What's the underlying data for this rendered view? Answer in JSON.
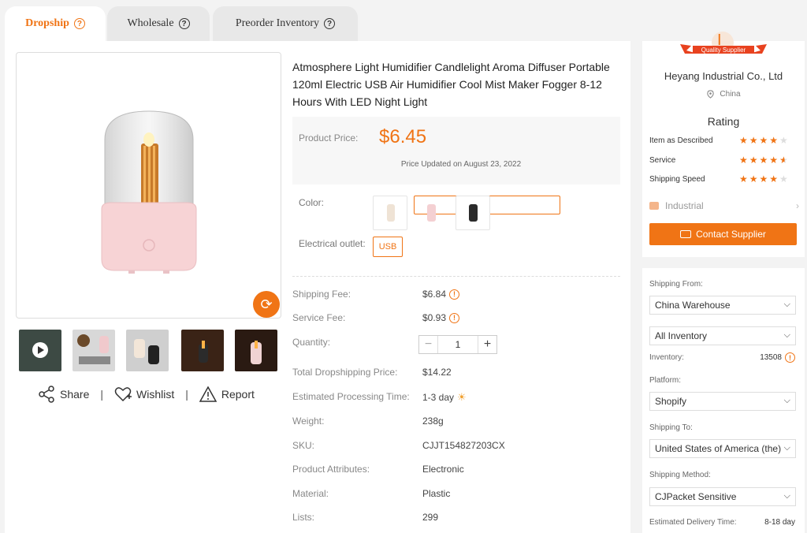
{
  "tabs": [
    {
      "label": "Dropship"
    },
    {
      "label": "Wholesale"
    },
    {
      "label": "Preorder Inventory"
    }
  ],
  "product": {
    "title": "Atmosphere Light Humidifier Candlelight Aroma Diffuser Portable 120ml Electric USB Air Humidifier Cool Mist Maker Fogger 8-12 Hours With LED Night Light",
    "price_label": "Product Price:",
    "price": "$6.45",
    "price_updated": "Price Updated on August 23, 2022",
    "color_label": "Color:",
    "outlet_label": "Electrical outlet:",
    "outlet_value": "USB"
  },
  "actions": {
    "share": "Share",
    "wishlist": "Wishlist",
    "report": "Report",
    "separator": "|"
  },
  "details": {
    "shipping_fee": {
      "label": "Shipping Fee:",
      "value": "$6.84"
    },
    "service_fee": {
      "label": "Service Fee:",
      "value": "$0.93"
    },
    "quantity": {
      "label": "Quantity:",
      "value": "1"
    },
    "total": {
      "label": "Total Dropshipping Price:",
      "value": "$14.22"
    },
    "processing": {
      "label": "Estimated Processing Time:",
      "value": "1-3 day"
    },
    "weight": {
      "label": "Weight:",
      "value": "238g"
    },
    "sku": {
      "label": "SKU:",
      "value": "CJJT154827203CX"
    },
    "attributes": {
      "label": "Product Attributes:",
      "value": "Electronic"
    },
    "material": {
      "label": "Material:",
      "value": "Plastic"
    },
    "lists": {
      "label": "Lists:",
      "value": "299"
    }
  },
  "supplier": {
    "initial": "I",
    "ribbon": "Quality Supplier",
    "name": "Heyang Industrial Co., Ltd",
    "location": "China",
    "rating_heading": "Rating",
    "ratings": [
      {
        "label": "Item as Described",
        "stars": 4
      },
      {
        "label": "Service",
        "stars": 4.5
      },
      {
        "label": "Shipping Speed",
        "stars": 4
      }
    ],
    "category": "Industrial",
    "contact_label": "Contact Supplier"
  },
  "shipping": {
    "from_label": "Shipping From:",
    "from_value": "China Warehouse",
    "inventory_select": "All Inventory",
    "inventory_label": "Inventory:",
    "inventory_value": "13508",
    "platform_label": "Platform:",
    "platform_value": "Shopify",
    "to_label": "Shipping To:",
    "to_value": "United States of America (the)",
    "method_label": "Shipping Method:",
    "method_value": "CJPacket Sensitive",
    "delivery_label": "Estimated Delivery Time:",
    "delivery_value": "8-18 day"
  },
  "colors": {
    "accent": "#f07415",
    "panel": "#ffffff",
    "background": "#f3f3f3"
  }
}
